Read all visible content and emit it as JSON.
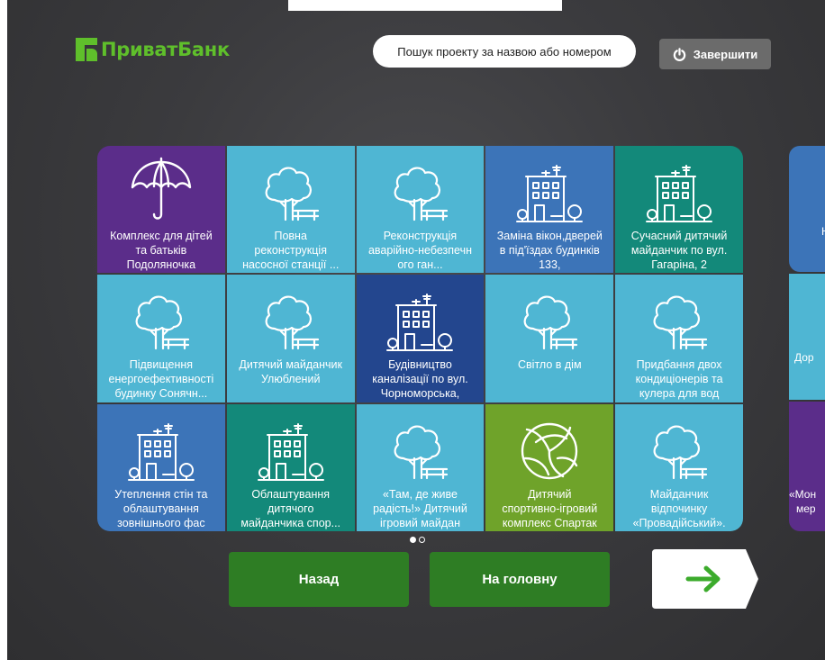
{
  "brand": {
    "name": "ПриватБанк",
    "accent": "#5fbf2b"
  },
  "header": {
    "search_placeholder": "Пошук проекту за назвою або номером",
    "finish_label": "Завершити",
    "finish_icon": "power-icon"
  },
  "tiles": [
    {
      "label": "Комплекс для дітей\nта батьків\nПодоляночка",
      "icon": "umbrella-icon",
      "color": "#5b2d8a"
    },
    {
      "label": "Повна\nреконструкція\nнасосної станції  ...",
      "icon": "tree-bench-icon",
      "color": "#4fb6d3"
    },
    {
      "label": "Реконструкція\nаварійно-небезпечн\nого ган...",
      "icon": "tree-bench-icon",
      "color": "#4fb6d3"
    },
    {
      "label": "Заміна вікон,дверей\nв під'їздах будинків\n133,",
      "icon": "building-icon",
      "color": "#3c74b8"
    },
    {
      "label": "Сучасний дитячий\nмайданчик по вул.\nГагаріна, 2",
      "icon": "building-icon",
      "color": "#13897a"
    },
    {
      "label": "Підвищення\nенергоефективності\nбудинку Сонячн...",
      "icon": "tree-bench-icon",
      "color": "#4fb6d3"
    },
    {
      "label": "Дитячий майданчик\nУлюблений",
      "icon": "tree-bench-icon",
      "color": "#4fb6d3"
    },
    {
      "label": "Будівництво\nканалізації по вул.\nЧорноморська,",
      "icon": "building-icon",
      "color": "#23468e"
    },
    {
      "label": "Світло в дім",
      "icon": "tree-bench-icon",
      "color": "#4fb6d3"
    },
    {
      "label": "Придбання двох\nкондиціонерів та\nкулера для вод",
      "icon": "tree-bench-icon",
      "color": "#4fb6d3"
    },
    {
      "label": "Утеплення стін та\nоблаштування\nзовнішнього фас",
      "icon": "building-icon",
      "color": "#3c74b8"
    },
    {
      "label": "Облаштування\nдитячого\nмайданчика спор...",
      "icon": "building-icon",
      "color": "#13897a"
    },
    {
      "label": "«Там, де живе\nрадість!» Дитячий\nігровий майдан",
      "icon": "tree-bench-icon",
      "color": "#4fb6d3"
    },
    {
      "label": "Дитячий\nспортивно-ігровий\nкомплекс Спартак",
      "icon": "volleyball-icon",
      "color": "#6fa32a"
    },
    {
      "label": "Майданчик\nвідпочинку\n«Провадійський».",
      "icon": "tree-bench-icon",
      "color": "#4fb6d3"
    }
  ],
  "side_peek": {
    "row1": "Н",
    "row2": "Дор",
    "row3a": "«Мон",
    "row3b": "мер"
  },
  "pagination": {
    "pages": 2,
    "current": 1
  },
  "nav": {
    "back_label": "Назад",
    "home_label": "На головну",
    "next_icon": "arrow-right-icon"
  }
}
